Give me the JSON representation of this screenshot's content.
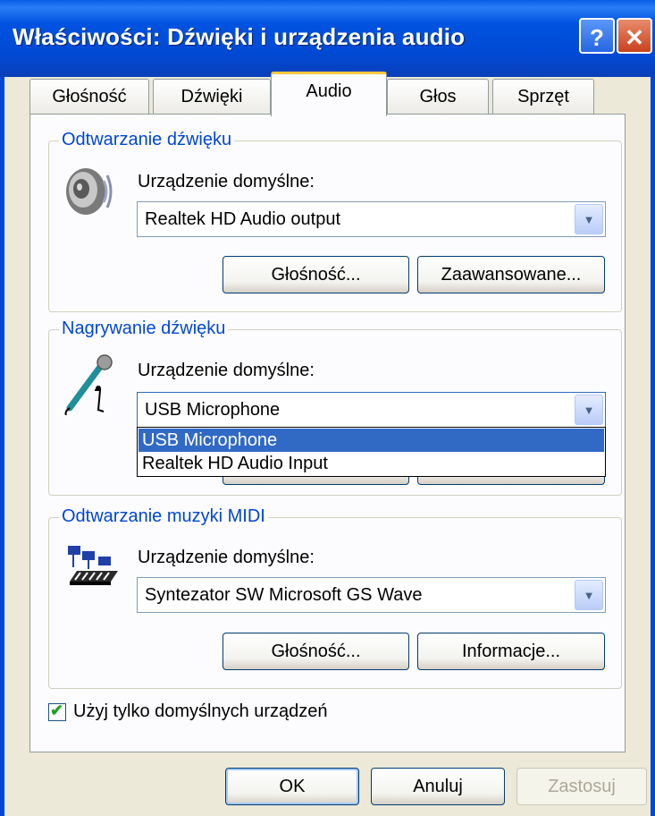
{
  "window": {
    "title": "Właściwości: Dźwięki i urządzenia audio",
    "help_glyph": "?",
    "close_glyph": "✕"
  },
  "tabs": [
    {
      "label": "Głośność",
      "active": false
    },
    {
      "label": "Dźwięki",
      "active": false
    },
    {
      "label": "Audio",
      "active": true
    },
    {
      "label": "Głos",
      "active": false
    },
    {
      "label": "Sprzęt",
      "active": false
    }
  ],
  "playback": {
    "group_title": "Odtwarzanie dźwięku",
    "default_label": "Urządzenie domyślne:",
    "device": "Realtek HD Audio output",
    "volume_button": "Głośność...",
    "advanced_button": "Zaawansowane..."
  },
  "recording": {
    "group_title": "Nagrywanie dźwięku",
    "default_label": "Urządzenie domyślne:",
    "device": "USB Microphone",
    "options": [
      "USB Microphone",
      "Realtek HD Audio Input"
    ],
    "selected_index": 0
  },
  "midi": {
    "group_title": "Odtwarzanie muzyki MIDI",
    "default_label": "Urządzenie domyślne:",
    "device": "Syntezator SW Microsoft GS Wave",
    "volume_button": "Głośność...",
    "info_button": "Informacje..."
  },
  "checkbox": {
    "label": "Użyj tylko domyślnych urządzeń",
    "checked": true,
    "glyph": "✔"
  },
  "footer": {
    "ok": "OK",
    "cancel": "Anuluj",
    "apply": "Zastosuj"
  },
  "icons": {
    "speaker": "speaker-icon",
    "microphone": "microphone-icon",
    "midi": "midi-keyboard-icon",
    "arrow": "▼"
  }
}
